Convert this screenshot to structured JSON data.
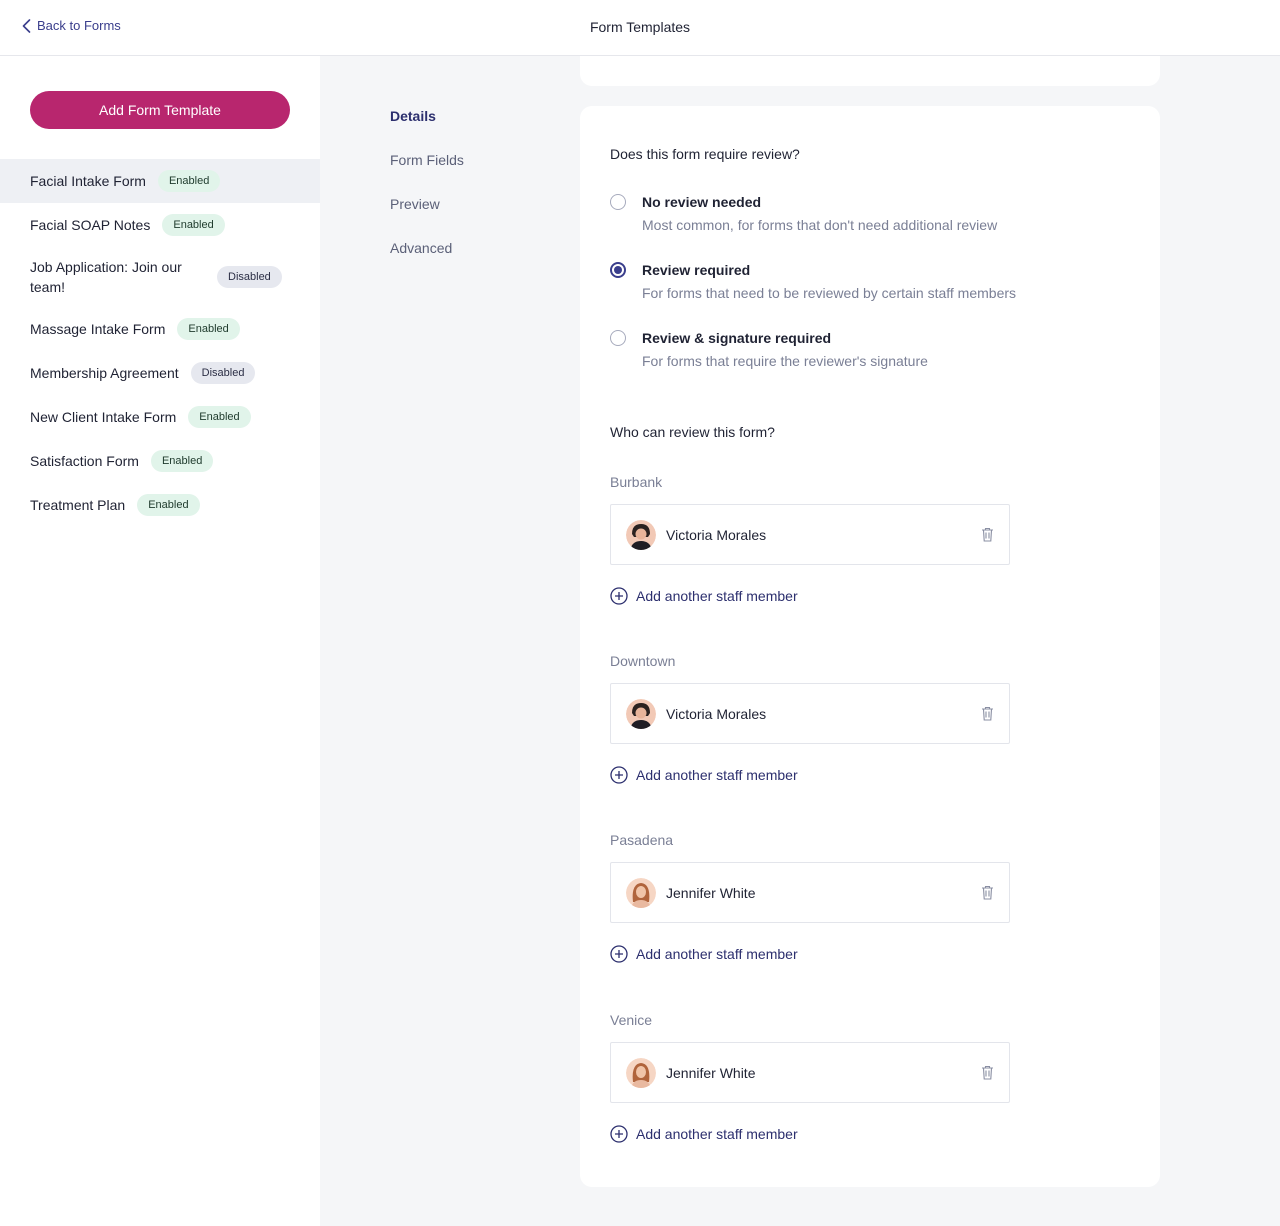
{
  "header": {
    "back_label": "Back to Forms",
    "title": "Form Templates"
  },
  "sidebar": {
    "add_button_label": "Add Form Template",
    "templates": [
      {
        "name": "Facial Intake Form",
        "status": "Enabled"
      },
      {
        "name": "Facial SOAP Notes",
        "status": "Enabled"
      },
      {
        "name": "Job Application: Join our team!",
        "status": "Disabled"
      },
      {
        "name": "Massage Intake Form",
        "status": "Enabled"
      },
      {
        "name": "Membership Agreement",
        "status": "Disabled"
      },
      {
        "name": "New Client Intake Form",
        "status": "Enabled"
      },
      {
        "name": "Satisfaction Form",
        "status": "Enabled"
      },
      {
        "name": "Treatment Plan",
        "status": "Enabled"
      }
    ]
  },
  "subnav": {
    "items": [
      "Details",
      "Form Fields",
      "Preview",
      "Advanced"
    ],
    "active": "Details"
  },
  "review": {
    "question": "Does this form require review?",
    "options": [
      {
        "title": "No review needed",
        "description": "Most common, for forms that don't need additional review",
        "checked": false
      },
      {
        "title": "Review required",
        "description": "For forms that need to be reviewed by certain staff members",
        "checked": true
      },
      {
        "title": "Review & signature required",
        "description": "For forms that require the reviewer's signature",
        "checked": false
      }
    ],
    "reviewers_question": "Who can review this form?",
    "add_staff_label": "Add another staff member",
    "locations": [
      {
        "name": "Burbank",
        "staff": "Victoria Morales",
        "avatar": "victoria-avatar"
      },
      {
        "name": "Downtown",
        "staff": "Victoria Morales",
        "avatar": "victoria-avatar"
      },
      {
        "name": "Pasadena",
        "staff": "Jennifer White",
        "avatar": "jennifer-avatar"
      },
      {
        "name": "Venice",
        "staff": "Jennifer White",
        "avatar": "jennifer-avatar"
      }
    ]
  },
  "colors": {
    "accent": "#b8266e",
    "primary": "#3a3e8c",
    "enabled_badge": "#e1f4ea",
    "disabled_badge": "#e6e8ef"
  }
}
